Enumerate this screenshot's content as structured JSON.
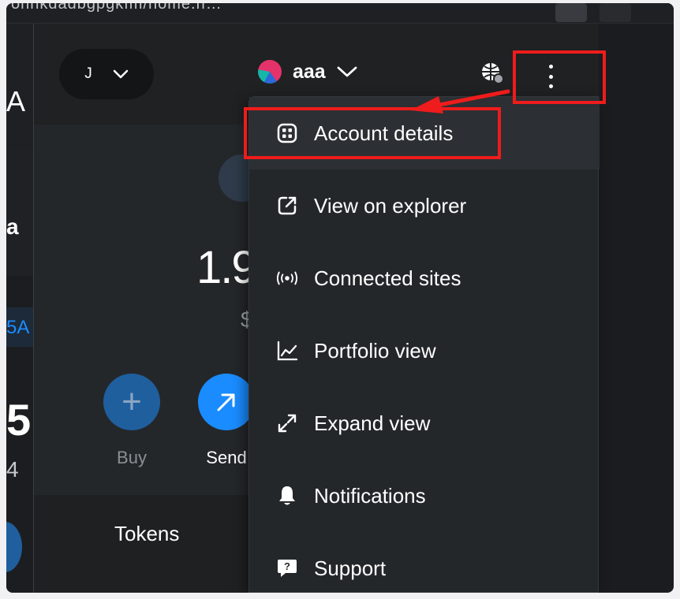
{
  "browser": {
    "url_fragment": "ohnkdadbgpgkfm/home.h…",
    "extensions": [
      "fox-extension-icon",
      "puzzle-icon"
    ]
  },
  "background_page": {
    "peek_letters": [
      "A",
      "a",
      "5A",
      "5",
      "4"
    ]
  },
  "popup": {
    "network": {
      "label": "J"
    },
    "account": {
      "name": "aaa"
    },
    "balance": {
      "amount": "1.9",
      "fiat": "$"
    },
    "actions": [
      {
        "label": "Buy",
        "icon": "plus-icon",
        "color": "#1f5f9e"
      },
      {
        "label": "Send",
        "icon": "arrow-up-right-icon",
        "color": "#1a8cff"
      }
    ],
    "tabs": {
      "tokens": "Tokens"
    }
  },
  "menu": {
    "items": [
      {
        "label": "Account details",
        "icon": "qr-icon"
      },
      {
        "label": "View on explorer",
        "icon": "external-link-icon"
      },
      {
        "label": "Connected sites",
        "icon": "broadcast-icon"
      },
      {
        "label": "Portfolio view",
        "icon": "chart-line-icon"
      },
      {
        "label": "Expand view",
        "icon": "expand-icon"
      },
      {
        "label": "Notifications",
        "icon": "bell-icon"
      },
      {
        "label": "Support",
        "icon": "support-chat-icon"
      }
    ]
  },
  "colors": {
    "highlight": "#ee1c1c",
    "popup_bg": "#24272a",
    "accent_blue": "#1a8cff"
  }
}
